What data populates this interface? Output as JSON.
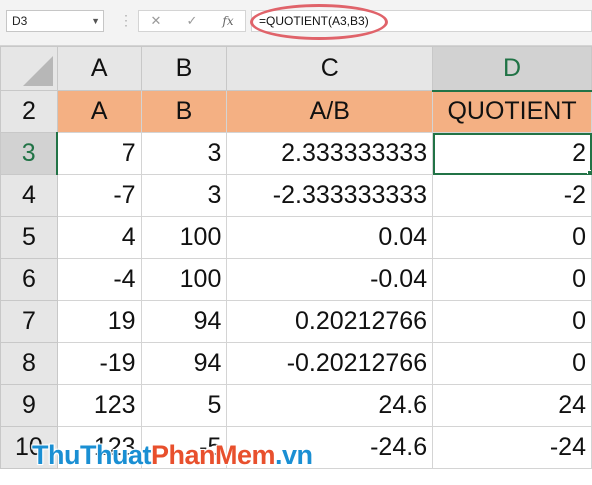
{
  "formula_bar": {
    "name_box": "D3",
    "name_box_dropdown_icon": "chevron-down-icon",
    "cancel_symbol": "✕",
    "enter_symbol": "✓",
    "function_symbol": "fx",
    "formula": "=QUOTIENT(A3,B3)",
    "highlight_color": "#e0636a"
  },
  "sheet": {
    "columns": [
      "A",
      "B",
      "C",
      "D"
    ],
    "active_column": "D",
    "active_row": "3",
    "active_cell": "D3",
    "header_fill_color": "#f4b083",
    "selection_color": "#217346",
    "rows": [
      {
        "row": "2",
        "cells": [
          "A",
          "B",
          "A/B",
          "QUOTIENT"
        ]
      },
      {
        "row": "3",
        "cells": [
          "7",
          "3",
          "2.333333333",
          "2"
        ]
      },
      {
        "row": "4",
        "cells": [
          "-7",
          "3",
          "-2.333333333",
          "-2"
        ]
      },
      {
        "row": "5",
        "cells": [
          "4",
          "100",
          "0.04",
          "0"
        ]
      },
      {
        "row": "6",
        "cells": [
          "-4",
          "100",
          "-0.04",
          "0"
        ]
      },
      {
        "row": "7",
        "cells": [
          "19",
          "94",
          "0.20212766",
          "0"
        ]
      },
      {
        "row": "8",
        "cells": [
          "-19",
          "94",
          "-0.20212766",
          "0"
        ]
      },
      {
        "row": "9",
        "cells": [
          "123",
          "5",
          "24.6",
          "24"
        ]
      },
      {
        "row": "10",
        "cells": [
          "123",
          "-5",
          "-24.6",
          "-24"
        ]
      }
    ]
  },
  "watermark": {
    "part1": "ThuThuat",
    "part2": "PhanMem",
    "part3": ".vn"
  }
}
